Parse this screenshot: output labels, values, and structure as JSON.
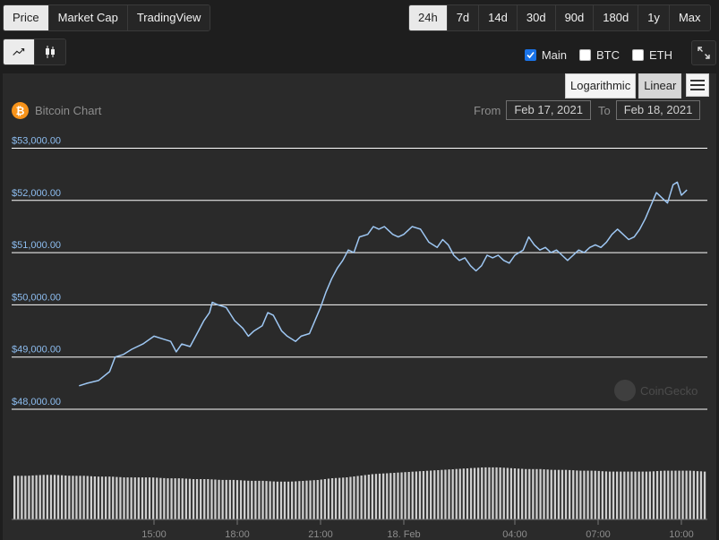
{
  "type_tabs": [
    {
      "label": "Price",
      "active": true
    },
    {
      "label": "Market Cap",
      "active": false
    },
    {
      "label": "TradingView",
      "active": false
    }
  ],
  "range_tabs": [
    {
      "label": "24h",
      "active": true
    },
    {
      "label": "7d",
      "active": false
    },
    {
      "label": "14d",
      "active": false
    },
    {
      "label": "30d",
      "active": false
    },
    {
      "label": "90d",
      "active": false
    },
    {
      "label": "180d",
      "active": false
    },
    {
      "label": "1y",
      "active": false
    },
    {
      "label": "Max",
      "active": false
    }
  ],
  "chart_style": {
    "line_icon": "line-chart-icon",
    "candle_icon": "candlestick-icon",
    "active": "line"
  },
  "series_toggles": [
    {
      "label": "Main",
      "checked": true
    },
    {
      "label": "BTC",
      "checked": false
    },
    {
      "label": "ETH",
      "checked": false
    }
  ],
  "scale": {
    "log_label": "Logarithmic",
    "linear_label": "Linear",
    "active": "linear"
  },
  "chart_header": {
    "icon_glyph": "₿",
    "title": "Bitcoin Chart",
    "from_label": "From",
    "from_date": "Feb 17, 2021",
    "to_label": "To",
    "to_date": "Feb 18, 2021"
  },
  "watermark": "CoinGecko",
  "colors": {
    "line": "#9ec7f3",
    "label": "#8dbdf0",
    "volume": "#cfcfcf",
    "grid": "#ffffff",
    "btc": "#f7931a"
  },
  "chart_data": {
    "type": "line",
    "title": "",
    "xlabel": "",
    "ylabel": "",
    "ylim": [
      47900,
      53150
    ],
    "xlim": [
      12.3,
      34.2
    ],
    "y_ticks": [
      48000,
      49000,
      50000,
      51000,
      52000,
      53000
    ],
    "y_tick_labels": [
      "$48,000.00",
      "$49,000.00",
      "$50,000.00",
      "$51,000.00",
      "$52,000.00",
      "$53,000.00"
    ],
    "x_ticks": [
      15,
      18,
      21,
      24,
      28,
      31,
      34
    ],
    "x_tick_labels": [
      "15:00",
      "18:00",
      "21:00",
      "18. Feb",
      "04:00",
      "07:00",
      "10:00"
    ],
    "grid": true,
    "series": [
      {
        "values": [
          [
            12.3,
            48450
          ],
          [
            12.6,
            48500
          ],
          [
            13.0,
            48550
          ],
          [
            13.4,
            48720
          ],
          [
            13.6,
            49000
          ],
          [
            13.9,
            49050
          ],
          [
            14.2,
            49150
          ],
          [
            14.6,
            49250
          ],
          [
            15.0,
            49400
          ],
          [
            15.3,
            49350
          ],
          [
            15.6,
            49300
          ],
          [
            15.8,
            49100
          ],
          [
            16.0,
            49250
          ],
          [
            16.3,
            49200
          ],
          [
            16.6,
            49500
          ],
          [
            16.8,
            49700
          ],
          [
            17.0,
            49850
          ],
          [
            17.1,
            50050
          ],
          [
            17.3,
            50000
          ],
          [
            17.6,
            49950
          ],
          [
            17.9,
            49700
          ],
          [
            18.2,
            49550
          ],
          [
            18.4,
            49400
          ],
          [
            18.6,
            49500
          ],
          [
            18.9,
            49600
          ],
          [
            19.1,
            49850
          ],
          [
            19.3,
            49800
          ],
          [
            19.6,
            49500
          ],
          [
            19.8,
            49400
          ],
          [
            20.1,
            49300
          ],
          [
            20.3,
            49400
          ],
          [
            20.6,
            49450
          ],
          [
            20.8,
            49700
          ],
          [
            21.0,
            49950
          ],
          [
            21.2,
            50250
          ],
          [
            21.4,
            50500
          ],
          [
            21.6,
            50700
          ],
          [
            21.8,
            50850
          ],
          [
            22.0,
            51050
          ],
          [
            22.2,
            51000
          ],
          [
            22.4,
            51300
          ],
          [
            22.7,
            51350
          ],
          [
            22.9,
            51500
          ],
          [
            23.1,
            51450
          ],
          [
            23.3,
            51500
          ],
          [
            23.6,
            51350
          ],
          [
            23.8,
            51300
          ],
          [
            24.0,
            51350
          ],
          [
            24.3,
            51500
          ],
          [
            24.6,
            51450
          ],
          [
            24.9,
            51200
          ],
          [
            25.2,
            51100
          ],
          [
            25.4,
            51250
          ],
          [
            25.6,
            51150
          ],
          [
            25.8,
            50950
          ],
          [
            26.0,
            50850
          ],
          [
            26.2,
            50900
          ],
          [
            26.4,
            50750
          ],
          [
            26.6,
            50650
          ],
          [
            26.8,
            50750
          ],
          [
            27.0,
            50950
          ],
          [
            27.2,
            50900
          ],
          [
            27.4,
            50950
          ],
          [
            27.6,
            50850
          ],
          [
            27.8,
            50800
          ],
          [
            28.0,
            50950
          ],
          [
            28.3,
            51050
          ],
          [
            28.5,
            51300
          ],
          [
            28.7,
            51150
          ],
          [
            28.9,
            51050
          ],
          [
            29.1,
            51100
          ],
          [
            29.3,
            51000
          ],
          [
            29.5,
            51050
          ],
          [
            29.7,
            50950
          ],
          [
            29.9,
            50850
          ],
          [
            30.1,
            50950
          ],
          [
            30.3,
            51050
          ],
          [
            30.5,
            51000
          ],
          [
            30.7,
            51100
          ],
          [
            30.9,
            51150
          ],
          [
            31.1,
            51100
          ],
          [
            31.3,
            51200
          ],
          [
            31.5,
            51350
          ],
          [
            31.7,
            51450
          ],
          [
            31.9,
            51350
          ],
          [
            32.1,
            51250
          ],
          [
            32.3,
            51300
          ],
          [
            32.5,
            51450
          ],
          [
            32.7,
            51650
          ],
          [
            32.9,
            51900
          ],
          [
            33.1,
            52150
          ],
          [
            33.3,
            52050
          ],
          [
            33.5,
            51950
          ],
          [
            33.7,
            52300
          ],
          [
            33.85,
            52350
          ],
          [
            34.0,
            52100
          ],
          [
            34.1,
            52150
          ],
          [
            34.2,
            52200
          ]
        ]
      }
    ],
    "volume": [
      0.52,
      0.52,
      0.53,
      0.53,
      0.52,
      0.52,
      0.51,
      0.51,
      0.5,
      0.5,
      0.5,
      0.49,
      0.49,
      0.48,
      0.48,
      0.47,
      0.47,
      0.46,
      0.46,
      0.45,
      0.45,
      0.46,
      0.47,
      0.49,
      0.5,
      0.52,
      0.54,
      0.55,
      0.56,
      0.57,
      0.58,
      0.59,
      0.6,
      0.61,
      0.62,
      0.62,
      0.61,
      0.6,
      0.6,
      0.59,
      0.59,
      0.58,
      0.58,
      0.57,
      0.57,
      0.57,
      0.57,
      0.58,
      0.58,
      0.58,
      0.57
    ]
  }
}
